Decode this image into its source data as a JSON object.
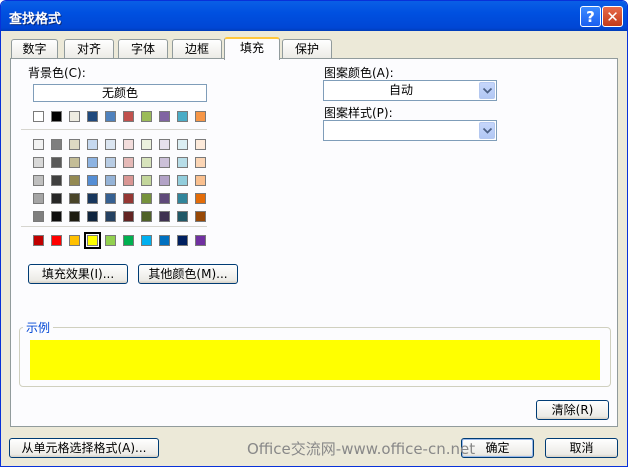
{
  "window": {
    "title": "查找格式",
    "help_glyph": "?",
    "close_glyph": "✕"
  },
  "tabs": [
    {
      "label": "数字"
    },
    {
      "label": "对齐"
    },
    {
      "label": "字体"
    },
    {
      "label": "边框"
    },
    {
      "label": "填充",
      "active": true
    },
    {
      "label": "保护"
    }
  ],
  "fill": {
    "background_color_label": "背景色(C):",
    "no_color_label": "无颜色",
    "theme_row_colors": [
      "#ffffff",
      "#000000",
      "#eeece1",
      "#1f497d",
      "#4f81bd",
      "#c0504d",
      "#9bbb59",
      "#8064a2",
      "#4bacc6",
      "#f79646"
    ],
    "tint_grid": [
      [
        "#f2f2f2",
        "#7f7f7f",
        "#ddd9c3",
        "#c6d9f0",
        "#dbe5f1",
        "#f2dcdb",
        "#ebf1dd",
        "#e5e0ec",
        "#dbeef3",
        "#fdeada"
      ],
      [
        "#d8d8d8",
        "#595959",
        "#c4bd97",
        "#8db3e2",
        "#b8cce4",
        "#e5b9b7",
        "#d7e3bc",
        "#ccc1d9",
        "#b7dde8",
        "#fbd5b5"
      ],
      [
        "#bfbfbf",
        "#3f3f3f",
        "#938953",
        "#548dd4",
        "#95b3d7",
        "#d99694",
        "#c3d69b",
        "#b2a2c7",
        "#92cddc",
        "#fac08f"
      ],
      [
        "#a5a5a5",
        "#262626",
        "#494429",
        "#17365d",
        "#366092",
        "#953734",
        "#76923c",
        "#5f497a",
        "#31859b",
        "#e36c09"
      ],
      [
        "#7f7f7f",
        "#0c0c0c",
        "#1d1b10",
        "#0f243e",
        "#244061",
        "#632423",
        "#4f6128",
        "#3f3151",
        "#205867",
        "#974806"
      ]
    ],
    "standard_colors": [
      "#c00000",
      "#ff0000",
      "#ffc000",
      "#ffff00",
      "#92d050",
      "#00b050",
      "#00b0f0",
      "#0070c0",
      "#002060",
      "#7030a0"
    ],
    "selected_standard_index": 3,
    "fill_effects_button": "填充效果(I)...",
    "more_colors_button": "其他颜色(M)...",
    "pattern_color_label": "图案颜色(A):",
    "pattern_color_value": "自动",
    "pattern_style_label": "图案样式(P):",
    "pattern_style_value": "",
    "sample_label": "示例",
    "sample_color": "#ffff00"
  },
  "buttons": {
    "clear": "清除(R)",
    "choose_from_cell": "从单元格选择格式(A)...",
    "ok": "确定",
    "cancel": "取消"
  },
  "watermark": "Office交流网-www.office-cn.net"
}
